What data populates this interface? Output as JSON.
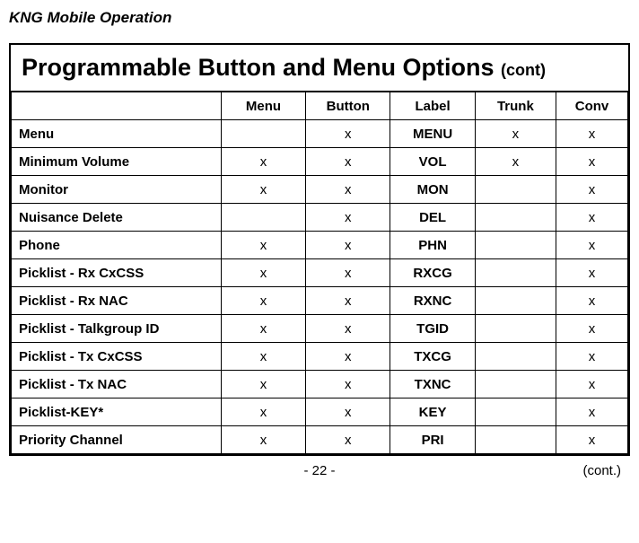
{
  "header": "KNG Mobile Operation",
  "title": "Programmable Button and Menu Options",
  "title_suffix": "(cont)",
  "columns": {
    "first": "",
    "menu": "Menu",
    "button": "Button",
    "label": "Label",
    "trunk": "Trunk",
    "conv": "Conv"
  },
  "rows": [
    {
      "name": "Menu",
      "menu": "",
      "button": "x",
      "label": "MENU",
      "trunk": "x",
      "conv": "x"
    },
    {
      "name": "Minimum Volume",
      "menu": "x",
      "button": "x",
      "label": "VOL",
      "trunk": "x",
      "conv": "x"
    },
    {
      "name": "Monitor",
      "menu": "x",
      "button": "x",
      "label": "MON",
      "trunk": "",
      "conv": "x"
    },
    {
      "name": "Nuisance Delete",
      "menu": "",
      "button": "x",
      "label": "DEL",
      "trunk": "",
      "conv": "x"
    },
    {
      "name": "Phone",
      "menu": "x",
      "button": "x",
      "label": "PHN",
      "trunk": "",
      "conv": "x"
    },
    {
      "name": "Picklist - Rx CxCSS",
      "menu": "x",
      "button": "x",
      "label": "RXCG",
      "trunk": "",
      "conv": "x"
    },
    {
      "name": "Picklist - Rx NAC",
      "menu": "x",
      "button": "x",
      "label": "RXNC",
      "trunk": "",
      "conv": "x"
    },
    {
      "name": "Picklist - Talkgroup ID",
      "menu": "x",
      "button": "x",
      "label": "TGID",
      "trunk": "",
      "conv": "x"
    },
    {
      "name": "Picklist - Tx CxCSS",
      "menu": "x",
      "button": "x",
      "label": "TXCG",
      "trunk": "",
      "conv": "x"
    },
    {
      "name": "Picklist - Tx NAC",
      "menu": "x",
      "button": "x",
      "label": "TXNC",
      "trunk": "",
      "conv": "x"
    },
    {
      "name": "Picklist-KEY*",
      "menu": "x",
      "button": "x",
      "label": "KEY",
      "trunk": "",
      "conv": "x"
    },
    {
      "name": "Priority Channel",
      "menu": "x",
      "button": "x",
      "label": "PRI",
      "trunk": "",
      "conv": "x"
    }
  ],
  "page_number": "- 22 -",
  "cont_label": "(cont.)"
}
